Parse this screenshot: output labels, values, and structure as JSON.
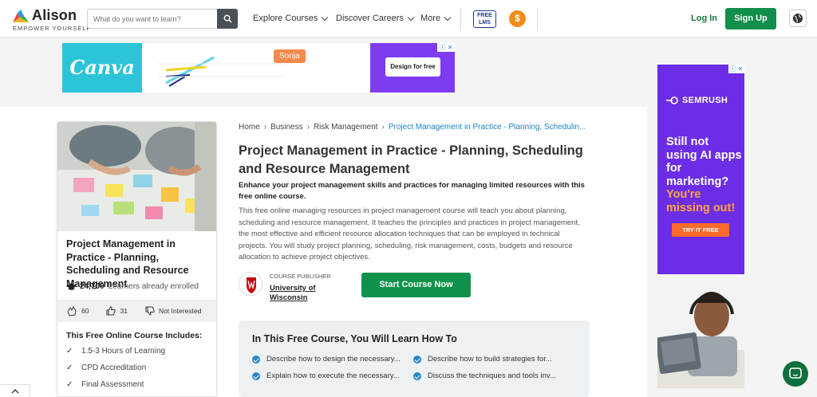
{
  "header": {
    "logo_name": "Alison",
    "logo_tagline": "EMPOWER YOURSELF",
    "search_placeholder": "What do you want to learn?",
    "nav": [
      "Explore Courses",
      "Discover Careers",
      "More"
    ],
    "free_lms": "FREE LMS",
    "dollar": "$",
    "login": "Log In",
    "signup": "Sign Up"
  },
  "ad_top": {
    "brand": "Canva",
    "tag_name": "Sonja",
    "cta": "Design for free"
  },
  "course_card": {
    "title": "Project Management in Practice - Planning, Scheduling and Resource Management",
    "enrolled_count": "24,700",
    "enrolled_label": "Learners already enrolled",
    "likes": "60",
    "thumbs_up": "31",
    "not_interested": "Not Interested",
    "includes_title": "This Free Online Course Includes:",
    "includes": [
      "1.5-3 Hours of Learning",
      "CPD Accreditation",
      "Final Assessment"
    ]
  },
  "breadcrumb": [
    "Home",
    "Business",
    "Risk Management",
    "Project Management in Practice - Planning, Schedulin..."
  ],
  "course": {
    "title": "Project Management in Practice - Planning, Scheduling and Resource Management",
    "subtitle": "Enhance your project management skills and practices for managing limited resources with this free online course.",
    "description": "This free online managing resources in project management course will teach you about planning, scheduling and resource management. It teaches the principles and practices in project management, the most effective and efficient resource allocation techniques that can be employed in technical projects. You will study project planning, scheduling, risk management, costs, budgets and resource allocation to achieve project objectives.",
    "publisher_label": "COURSE PUBLISHER",
    "publisher_name": "University of Wisconsin",
    "start_button": "Start Course Now"
  },
  "learn": {
    "title": "In This Free Course, You Will Learn How To",
    "items": [
      "Describe how to design the necessary...",
      "Describe how to build strategies for...",
      "Explain how to execute the necessary...",
      "Discuss the techniques and tools inv..."
    ]
  },
  "ad_right": {
    "brand": "SEMRUSH",
    "line1": "Still not using AI apps for marketing?",
    "line2": "You're missing out!",
    "cta": "TRY IT FREE"
  },
  "colors": {
    "accent_green": "#0f8f4a",
    "link_blue": "#1b84c6",
    "semrush_purple": "#6c2de6"
  }
}
